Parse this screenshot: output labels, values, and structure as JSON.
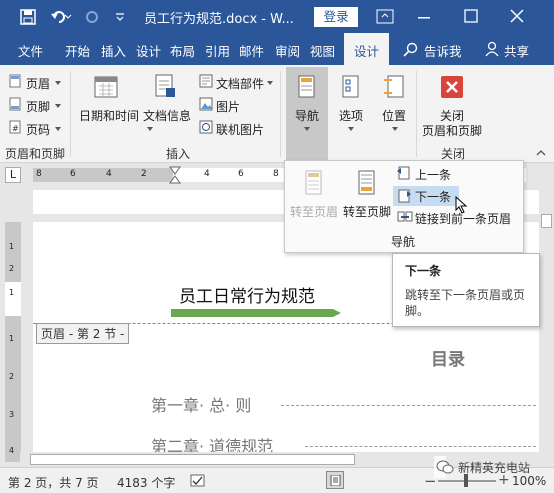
{
  "titlebar": {
    "title": "员工行为规范.docx - W...",
    "login": "登录"
  },
  "tabs": [
    "文件",
    "开始",
    "插入",
    "设计",
    "布局",
    "引用",
    "邮件",
    "审阅",
    "视图",
    "设计"
  ],
  "tell_me": "告诉我",
  "share": "共享",
  "ribbon": {
    "header": "页眉",
    "footer": "页脚",
    "page_number": "页码",
    "group_header_footer": "页眉和页脚",
    "date_time": "日期和时间",
    "doc_info": "文档信息",
    "doc_parts": "文档部件",
    "pictures": "图片",
    "online_pictures": "联机图片",
    "group_insert": "插入",
    "navigation": "导航",
    "options": "选项",
    "position": "位置",
    "close_line1": "关闭",
    "close_line2": "页眉和页脚",
    "group_close": "关闭"
  },
  "ruler": {
    "nums_left": [
      "8",
      "6",
      "4",
      "2"
    ],
    "nums_right": [
      "4",
      "6",
      "8"
    ]
  },
  "vruler": [
    "1",
    "2",
    "1",
    "1",
    "2",
    "3",
    "4"
  ],
  "navdrop": {
    "goto_header": "转至页眉",
    "goto_footer": "转至页脚",
    "prev": "上一条",
    "next": "下一条",
    "link_prev": "链接到前一条页眉",
    "group": "导航"
  },
  "tooltip": {
    "title": "下一条",
    "body_line1": "跳转至下一条页眉或页",
    "body_line2": "脚。"
  },
  "document": {
    "header_text": "员工日常行为规范",
    "header_tag": "页眉 - 第 2 节 -",
    "toc_title": "目录",
    "chapter1": "第一章· 总· 则",
    "chapter2": "第二章· 道德规范"
  },
  "status": {
    "page": "第 2 页，共 7 页",
    "words": "4183 个字",
    "zoom": "100%"
  },
  "watermark": "新精英充电站"
}
